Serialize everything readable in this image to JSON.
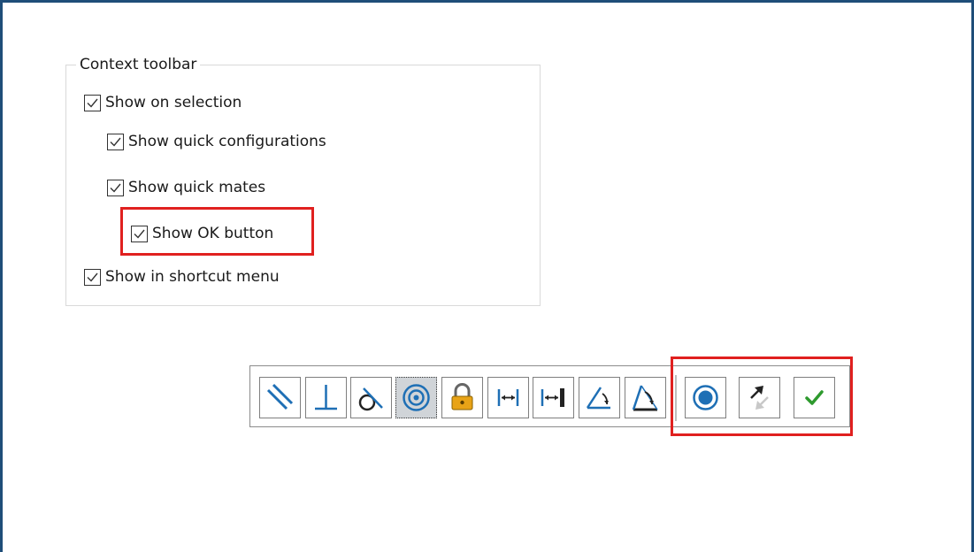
{
  "group": {
    "legend": "Context toolbar",
    "options": [
      {
        "label": "Show on selection",
        "checked": true
      },
      {
        "label": "Show quick configurations",
        "checked": true
      },
      {
        "label": "Show quick mates",
        "checked": true
      },
      {
        "label": "Show OK button",
        "checked": true
      },
      {
        "label": "Show in shortcut menu",
        "checked": true
      }
    ]
  },
  "toolbar": {
    "mate_buttons": [
      {
        "icon": "parallel-icon"
      },
      {
        "icon": "perpendicular-icon"
      },
      {
        "icon": "tangent-icon"
      },
      {
        "icon": "concentric-icon",
        "pressed": true
      },
      {
        "icon": "lock-icon"
      },
      {
        "icon": "distance-icon"
      },
      {
        "icon": "distance-limit-icon"
      },
      {
        "icon": "angle-icon"
      },
      {
        "icon": "angle-limit-icon"
      }
    ],
    "action_buttons": [
      {
        "icon": "aligned-radio-icon"
      },
      {
        "icon": "flip-alignment-icon"
      },
      {
        "icon": "ok-checkmark-icon"
      }
    ]
  },
  "colors": {
    "frame": "#1f4e79",
    "highlight": "#e0201f",
    "icon_blue": "#1e6fb5",
    "ok_green": "#2e9a2e"
  }
}
